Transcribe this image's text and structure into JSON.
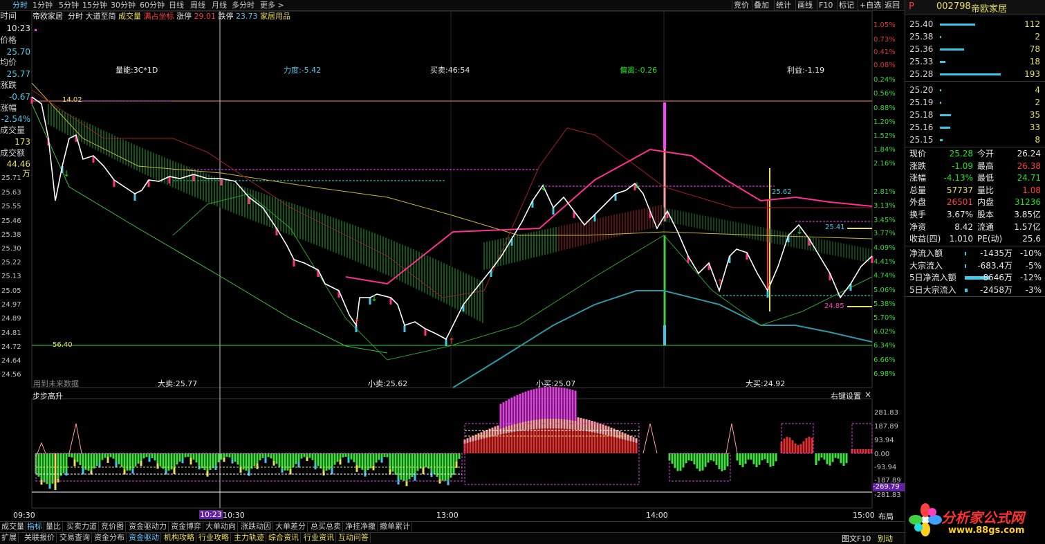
{
  "topbar": {
    "tabs": [
      "分时",
      "1分钟",
      "5分钟",
      "15分钟",
      "30分钟",
      "60分钟",
      "日线",
      "周线",
      "月线",
      "多分时",
      "更多 >"
    ],
    "right_buttons": [
      "竞价",
      "叠加",
      "统计",
      "画线",
      "F10",
      "标记",
      "+自选",
      "返回"
    ]
  },
  "header": {
    "stock_name": "帝欧家居",
    "mode": "分时",
    "formula": "大道至简",
    "volume_label": "成交量",
    "coord_label": "满占坐标",
    "limit_up_label": "涨停",
    "limit_up": "29.01",
    "limit_down_label": "跌停",
    "limit_down": "23.73",
    "sector": "家居用品"
  },
  "leftinfo": {
    "time_label": "时间",
    "time": "10:23",
    "price_label": "价格",
    "price": "25.70",
    "avg_label": "均价",
    "avg": "25.77",
    "chg_label": "涨跌",
    "chg": "-0.67",
    "pct_label": "涨幅",
    "pct": "-2.54%",
    "vol_label": "成交量",
    "vol": "173",
    "amt_label": "成交额",
    "amt": "44.46万"
  },
  "price_axis": {
    "left": [
      "25.71",
      "25.63",
      "25.55",
      "25.46",
      "25.38",
      "25.30",
      "25.22",
      "25.13",
      "25.05",
      "24.97",
      "24.89",
      "24.81",
      "24.72",
      "24.64",
      "24.56"
    ],
    "right": [
      "1.05%",
      "0.73%",
      "0.41%",
      "0.08%",
      "0.24%",
      "0.56%",
      "0.88%",
      "1.20%",
      "1.52%",
      "1.84%",
      "2.16%",
      "2.81%",
      "3.13%",
      "3.45%",
      "3.77%",
      "4.09%",
      "4.41%",
      "4.74%",
      "5.06%",
      "5.38%",
      "5.70%",
      "6.02%",
      "6.34%",
      "6.66%",
      "6.98%"
    ]
  },
  "indicators": {
    "liangneng": "量能:3C*1D",
    "lidu": "力度:-5.42",
    "maimai": "买卖:46:54",
    "pianli": "偏离:-0.26",
    "liyi": "利益:-1.19",
    "dasell": "大卖:25.77",
    "xiaosell": "小卖:25.62",
    "xiaobuy": "小买:25.07",
    "dabuy": "大买:24.92",
    "future": "用到未来数据",
    "lvl_top": "14.02",
    "lvl_bottom": "56.40",
    "lbl_2562": "25.62",
    "lbl_2541": "25.41",
    "lbl_2485": "24.85"
  },
  "subchart": {
    "title": "步步高升",
    "settings": "右键设置",
    "close": "×",
    "axis": [
      "281.83",
      "187.89",
      "93.94",
      "0.00",
      "-93.94",
      "-187.89",
      "-281.83"
    ],
    "current": "-269.79"
  },
  "time_axis": {
    "labels": [
      "09:30",
      "10:30",
      "13:00",
      "14:00",
      "15:00"
    ],
    "cursor": "10:23",
    "layout_label": "布局"
  },
  "bottom_tabs": [
    "成交量",
    "指标",
    "量比",
    "买卖力道",
    "竞价图",
    "资金驱动力",
    "资金博弈",
    "大单动向",
    "涨跌动因",
    "大单差分",
    "总买总卖",
    "净挂净撤",
    "撤单累计"
  ],
  "bottom_tabs2": [
    "扩展",
    "关联报价",
    "交易查询",
    "资金分布",
    "资金驱动",
    "机构攻略",
    "行业攻略",
    "主力轨迹",
    "综合资讯",
    "行业资讯",
    "互动问答"
  ],
  "order_panel": {
    "flag": "P",
    "code": "002798",
    "name": "帝欧家居",
    "asks": [
      {
        "price": "25.40",
        "qty": "112",
        "level": 0.58
      },
      {
        "price": "25.38",
        "qty": "2",
        "level": 0.02
      },
      {
        "price": "25.36",
        "qty": "78",
        "level": 0.4
      },
      {
        "price": "25.33",
        "qty": "18",
        "level": 0.09
      },
      {
        "price": "25.28",
        "qty": "193",
        "level": 1.0
      }
    ],
    "bids": [
      {
        "price": "25.20",
        "qty": "4",
        "level": 0.02
      },
      {
        "price": "25.19",
        "qty": "2",
        "level": 0.01
      },
      {
        "price": "25.18",
        "qty": "35",
        "level": 0.18
      },
      {
        "price": "25.16",
        "qty": "33",
        "level": 0.17
      },
      {
        "price": "25.15",
        "qty": "8",
        "level": 0.04
      }
    ],
    "quote": [
      {
        "l1": "现价",
        "v1": "25.28",
        "c1": "grn",
        "l2": "今开",
        "v2": "26.24",
        "c2": "wht"
      },
      {
        "l1": "涨跌",
        "v1": "-1.09",
        "c1": "grn",
        "l2": "最高",
        "v2": "26.38",
        "c2": "red"
      },
      {
        "l1": "涨幅",
        "v1": "-4.13%",
        "c1": "grn",
        "l2": "最低",
        "v2": "24.71",
        "c2": "grn"
      },
      {
        "l1": "总量",
        "v1": "57737",
        "c1": "yel",
        "l2": "量比",
        "v2": "1.08",
        "c2": "red"
      },
      {
        "l1": "外盘",
        "v1": "26501",
        "c1": "red",
        "l2": "内盘",
        "v2": "31236",
        "c2": "grn"
      },
      {
        "l1": "换手",
        "v1": "3.67%",
        "c1": "wht",
        "l2": "股本",
        "v2": "3.85亿",
        "c2": "wht"
      },
      {
        "l1": "净资",
        "v1": "8.42",
        "c1": "wht",
        "l2": "流通",
        "v2": "1.57亿",
        "c2": "wht"
      },
      {
        "l1": "收益(四)",
        "v1": "1.010",
        "c1": "wht",
        "l2": "PE(动)",
        "v2": "25.6",
        "c2": "wht"
      }
    ],
    "flows": [
      {
        "label": "净流入额",
        "val": "-1435万",
        "pct": "-10%",
        "level": 0.03
      },
      {
        "label": "大宗流入",
        "val": "-683.4万",
        "pct": "-5%",
        "level": 0.01
      },
      {
        "label": "5日净流入额",
        "val": "-8646万",
        "pct": "-12%",
        "level": 0.6
      },
      {
        "label": "5日大宗流入",
        "val": "-2458万",
        "pct": "-3%",
        "level": 0.06
      }
    ],
    "watermark": "分析家公式网",
    "watermark_url": "www.88gs.com",
    "f10": "图文F10",
    "misc": "别动"
  },
  "colors": {
    "up": "#ff3030",
    "down": "#20e020",
    "cyan": "#40c8e8",
    "magenta": "#ff40c0",
    "yellow": "#e8e058",
    "price_line": "#ffffff"
  }
}
